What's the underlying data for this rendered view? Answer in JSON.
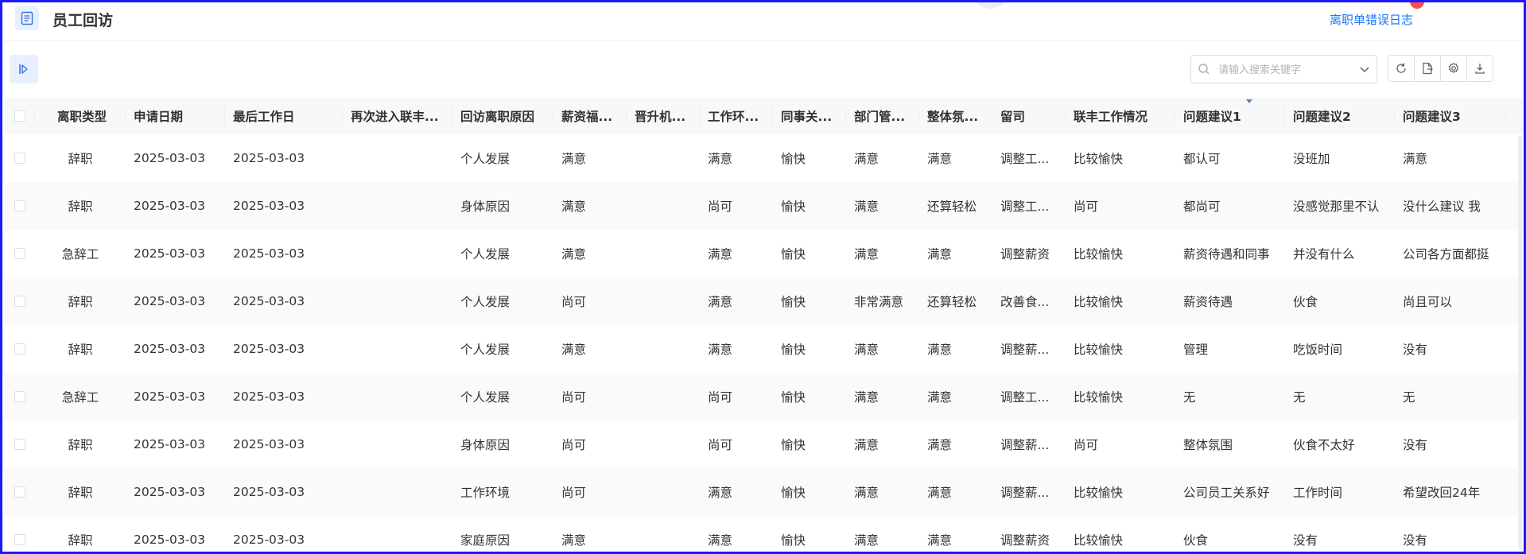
{
  "header": {
    "title": "员工回访",
    "error_log_link": "离职单错误日志"
  },
  "toolbar": {
    "search_placeholder": "请输入搜索关键字",
    "search_value": "",
    "buttons": [
      "refresh-icon",
      "export-file-icon",
      "settings-icon",
      "download-icon"
    ]
  },
  "table": {
    "columns": [
      "离职类型",
      "申请日期",
      "最后工作日",
      "再次进入联丰...",
      "回访离职原因",
      "薪资福...",
      "晋升机...",
      "工作环...",
      "同事关...",
      "部门管...",
      "整体氛...",
      "留司",
      "联丰工作情况",
      "问题建议1",
      "问题建议2",
      "问题建议3"
    ],
    "rows": [
      [
        "辞职",
        "2025-03-03",
        "2025-03-03",
        "",
        "个人发展",
        "满意",
        "",
        "满意",
        "愉快",
        "满意",
        "满意",
        "调整工...",
        "比较愉快",
        "都认可",
        "没班加",
        "满意"
      ],
      [
        "辞职",
        "2025-03-03",
        "2025-03-03",
        "",
        "身体原因",
        "满意",
        "",
        "尚可",
        "愉快",
        "满意",
        "还算轻松",
        "调整工...",
        "尚可",
        "都尚可",
        "没感觉那里不认",
        "没什么建议 我"
      ],
      [
        "急辞工",
        "2025-03-03",
        "2025-03-03",
        "",
        "个人发展",
        "满意",
        "",
        "满意",
        "愉快",
        "满意",
        "满意",
        "调整薪资",
        "比较愉快",
        "薪资待遇和同事",
        "并没有什么",
        "公司各方面都挺"
      ],
      [
        "辞职",
        "2025-03-03",
        "2025-03-03",
        "",
        "个人发展",
        "尚可",
        "",
        "满意",
        "愉快",
        "非常满意",
        "还算轻松",
        "改善食...",
        "比较愉快",
        "薪资待遇",
        "伙食",
        "尚且可以"
      ],
      [
        "辞职",
        "2025-03-03",
        "2025-03-03",
        "",
        "个人发展",
        "满意",
        "",
        "满意",
        "愉快",
        "满意",
        "满意",
        "调整薪...",
        "比较愉快",
        "管理",
        "吃饭时间",
        "没有"
      ],
      [
        "急辞工",
        "2025-03-03",
        "2025-03-03",
        "",
        "个人发展",
        "尚可",
        "",
        "尚可",
        "愉快",
        "满意",
        "满意",
        "调整工...",
        "比较愉快",
        "无",
        "无",
        "无"
      ],
      [
        "辞职",
        "2025-03-03",
        "2025-03-03",
        "",
        "身体原因",
        "尚可",
        "",
        "尚可",
        "愉快",
        "满意",
        "满意",
        "调整薪...",
        "尚可",
        "整体氛围",
        "伙食不太好",
        "没有"
      ],
      [
        "辞职",
        "2025-03-03",
        "2025-03-03",
        "",
        "工作环境",
        "尚可",
        "",
        "满意",
        "愉快",
        "满意",
        "满意",
        "调整薪...",
        "比较愉快",
        "公司员工关系好",
        "工作时间",
        "希望改回24年"
      ],
      [
        "辞职",
        "2025-03-03",
        "2025-03-03",
        "",
        "家庭原因",
        "满意",
        "",
        "满意",
        "愉快",
        "满意",
        "满意",
        "调整薪资",
        "比较愉快",
        "伙食",
        "没有",
        "没有"
      ]
    ]
  }
}
